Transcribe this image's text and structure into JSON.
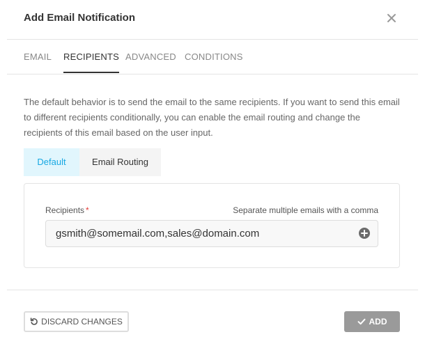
{
  "dialog": {
    "title": "Add Email Notification",
    "close_icon": "close-icon"
  },
  "tabs": [
    {
      "label": "EMAIL",
      "active": false
    },
    {
      "label": "RECIPIENTS",
      "active": true
    },
    {
      "label": "ADVANCED",
      "active": false
    },
    {
      "label": "CONDITIONS",
      "active": false
    }
  ],
  "description": "The default behavior is to send the email to the same recipients. If you want to send this email to different recipients conditionally, you can enable the email routing and change the recipients of this email based on the user input.",
  "mode_toggle": {
    "options": [
      "Default",
      "Email Routing"
    ],
    "selected": "Default"
  },
  "recipients": {
    "label": "Recipients",
    "required_marker": "*",
    "hint": "Separate multiple emails with a comma",
    "value": "gsmith@somemail.com,sales@domain.com",
    "add_icon": "plus-circle-icon"
  },
  "footer": {
    "discard_label": "DISCARD CHANGES",
    "discard_icon": "undo-icon",
    "add_label": "ADD",
    "add_icon": "checkmark-icon"
  },
  "colors": {
    "accent": "#17a8e3",
    "accent_bg": "#e1f6fd",
    "required": "#e53935",
    "add_button": "#9a9a9a"
  }
}
